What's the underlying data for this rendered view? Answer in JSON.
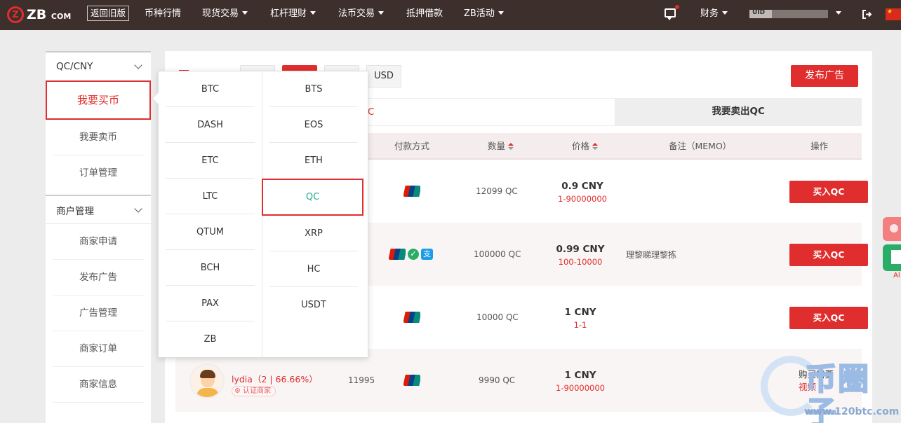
{
  "header": {
    "logo_text": "ZB",
    "logo_suffix": "COM",
    "old_version": "返回旧版",
    "nav": [
      {
        "label": "币种行情",
        "caret": false
      },
      {
        "label": "现货交易",
        "caret": true
      },
      {
        "label": "杠杆理财",
        "caret": true
      },
      {
        "label": "法币交易",
        "caret": true
      },
      {
        "label": "抵押借款",
        "caret": false
      },
      {
        "label": "ZB活动",
        "caret": true
      }
    ],
    "finance": "财务",
    "uid_label": "UID"
  },
  "sidebar": {
    "section1": "QC/CNY",
    "buy": "我要买币",
    "sell": "我要卖币",
    "orders": "订单管理",
    "section2": "商户管理",
    "merchant_items": [
      "商家申请",
      "发布广告",
      "广告管理",
      "商家订单",
      "商家信息"
    ]
  },
  "currency": {
    "usd": "USD",
    "publish_button": "发布广告"
  },
  "tabs": {
    "buy_fragment": "C",
    "sell": "我要卖出QC"
  },
  "table": {
    "headers": {
      "pay": "付款方式",
      "amount": "数量",
      "price": "价格",
      "memo": "备注（MEMO）",
      "action": "操作"
    }
  },
  "rows": [
    {
      "amount": "12099 QC",
      "price": "0.9 CNY",
      "limit": "1-90000000",
      "memo": "",
      "action": "买入QC",
      "pay": [
        "unionpay"
      ]
    },
    {
      "amount": "100000 QC",
      "price": "0.99 CNY",
      "limit": "100-10000",
      "memo": "理黎睇理黎拣",
      "action": "买入QC",
      "pay": [
        "unionpay",
        "wechat",
        "alipay"
      ]
    },
    {
      "amount": "10000 QC",
      "price": "1 CNY",
      "limit": "1-1",
      "memo": "",
      "action": "买入QC",
      "pay": [
        "unionpay"
      ]
    },
    {
      "merchant": "lydia（2 | 66.66%）",
      "badge": "认证商家",
      "trades": "11995",
      "amount": "9990 QC",
      "price": "1 CNY",
      "limit": "1-90000000",
      "note1": "购买需要",
      "note2": "视频",
      "pay": [
        "unionpay"
      ]
    }
  ],
  "dropdown": {
    "left": [
      "BTC",
      "DASH",
      "ETC",
      "LTC",
      "QTUM",
      "BCH",
      "PAX",
      "ZB"
    ],
    "right": [
      "BTS",
      "EOS",
      "ETH",
      "QC",
      "XRP",
      "HC",
      "USDT"
    ]
  },
  "float_label": "Al",
  "watermark": {
    "text": "币圈子",
    "url": "www.120btc.com"
  },
  "colors": {
    "accent": "#e02d2d",
    "topbar": "#3d2f2c",
    "selected_coin": "#24a98e"
  }
}
